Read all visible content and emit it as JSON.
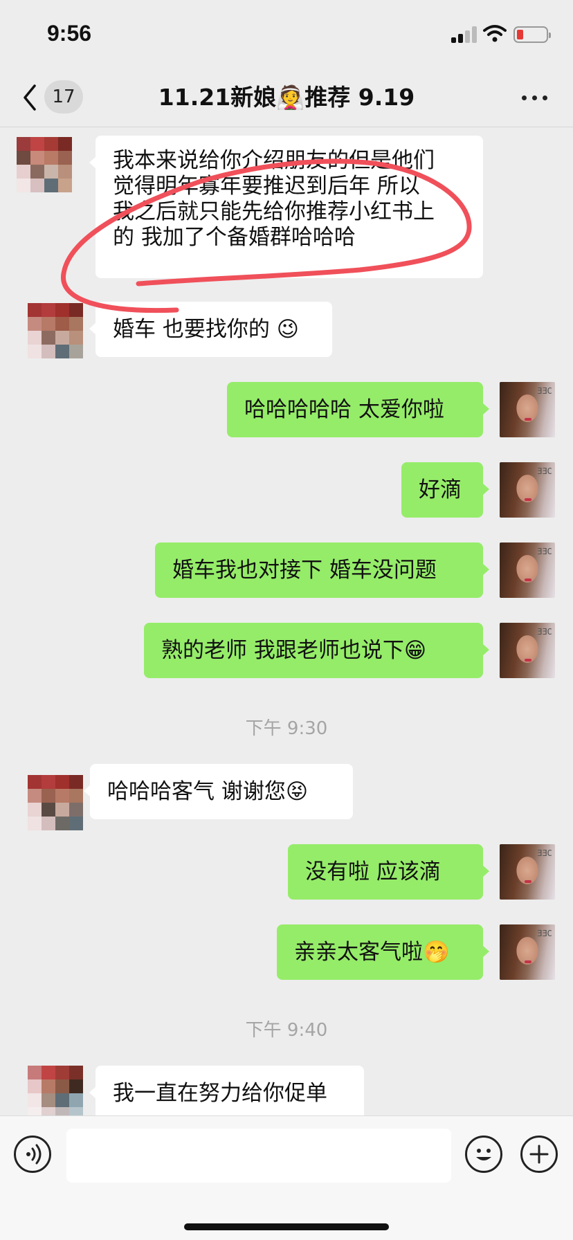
{
  "status_bar": {
    "time": "9:56",
    "battery_color": "#e53935"
  },
  "header": {
    "unread_count": "17",
    "title": "11.21新娘👰推荐 9.19",
    "back_icon": "chevron-left-icon",
    "more_icon": "more-dots-icon"
  },
  "messages": [
    {
      "side": "in",
      "lines": [
        "我本来说给你介绍朋友的但是他们",
        "觉得明年寡年要推迟到后年 所以",
        "我之后就只能先给你推荐小红书上",
        "的  我加了个备婚群哈哈哈"
      ]
    },
    {
      "side": "in",
      "text": "婚车 也要找你的 😉"
    },
    {
      "side": "out",
      "text": "哈哈哈哈哈 太爱你啦"
    },
    {
      "side": "out",
      "text": "好滴"
    },
    {
      "side": "out",
      "text": "婚车我也对接下 婚车没问题"
    },
    {
      "side": "out",
      "text": "熟的老师  我跟老师也说下😁"
    },
    {
      "side": "in",
      "text": "哈哈哈客气 谢谢您😝"
    },
    {
      "side": "out",
      "text": "没有啦 应该滴"
    },
    {
      "side": "out",
      "text": "亲亲太客气啦🤭"
    },
    {
      "side": "in",
      "text": "我一直在努力给你促单"
    }
  ],
  "timestamps": [
    "下午 9:30",
    "下午 9:40"
  ],
  "input_bar": {
    "placeholder": "",
    "voice_icon": "voice-icon",
    "emoji_icon": "emoji-icon",
    "plus_icon": "plus-icon"
  },
  "colors": {
    "outgoing_bubble": "#95ec69",
    "incoming_bubble": "#ffffff",
    "background": "#ededed",
    "annotation": "#f0505a"
  }
}
